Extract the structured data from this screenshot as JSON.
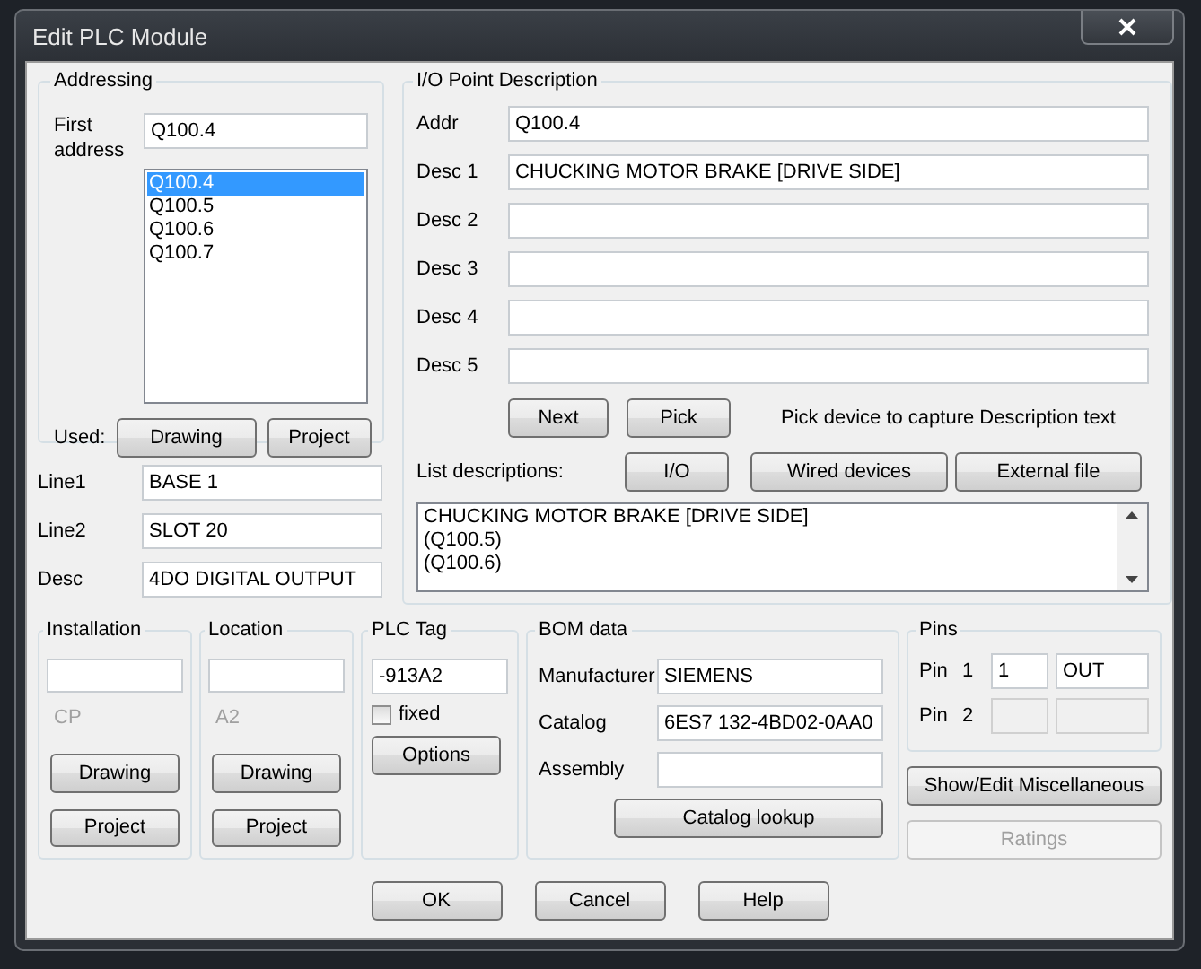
{
  "window": {
    "title": "Edit PLC Module"
  },
  "addressing": {
    "title": "Addressing",
    "first_address_label": "First address",
    "first_address": "Q100.4",
    "addresses": [
      {
        "label": "Q100.4",
        "selected": true
      },
      {
        "label": "Q100.5",
        "selected": false
      },
      {
        "label": "Q100.6",
        "selected": false
      },
      {
        "label": "Q100.7",
        "selected": false
      }
    ],
    "used_label": "Used:",
    "used_buttons": [
      "Drawing",
      "Project"
    ]
  },
  "module_fields": [
    {
      "label": "Line1",
      "value": "BASE 1"
    },
    {
      "label": "Line2",
      "value": "SLOT 20"
    },
    {
      "label": "Desc",
      "value": "4DO DIGITAL OUTPUT"
    }
  ],
  "io_point": {
    "title": "I/O Point Description",
    "fields": [
      {
        "label": "Addr",
        "value": "Q100.4"
      },
      {
        "label": "Desc 1",
        "value": "CHUCKING MOTOR BRAKE [DRIVE SIDE]"
      },
      {
        "label": "Desc 2"
      },
      {
        "label": "Desc 3"
      },
      {
        "label": "Desc 4"
      },
      {
        "label": "Desc 5"
      }
    ],
    "buttons": [
      "Next",
      "Pick"
    ],
    "pick_hint": "Pick device to capture Description text",
    "list_label": "List descriptions:",
    "list_buttons": [
      "I/O",
      "Wired devices",
      "External file"
    ],
    "descriptions": [
      "CHUCKING MOTOR BRAKE [DRIVE SIDE]",
      "(Q100.5)",
      "(Q100.6)"
    ]
  },
  "installation": {
    "title": "Installation",
    "current": "CP",
    "buttons": [
      "Drawing",
      "Project"
    ]
  },
  "location": {
    "title": "Location",
    "current": "A2",
    "buttons": [
      "Drawing",
      "Project"
    ]
  },
  "plc_tag": {
    "title": "PLC Tag",
    "value": "-913A2",
    "fixed_label": "fixed",
    "fixed": false,
    "button": "Options"
  },
  "bom": {
    "title": "BOM data",
    "fields": [
      {
        "label": "Manufacturer",
        "value": "SIEMENS"
      },
      {
        "label": "Catalog",
        "value": "6ES7 132-4BD02-0AA0"
      },
      {
        "label": "Assembly"
      }
    ],
    "button": "Catalog lookup"
  },
  "pins": {
    "title": "Pins",
    "rows": [
      {
        "label": "Pin",
        "number_label": "1",
        "pin": "1",
        "function": "OUT",
        "disabled": false
      },
      {
        "label": "Pin",
        "number_label": "2",
        "disabled": true
      }
    ]
  },
  "side_buttons": [
    {
      "label": "Show/Edit Miscellaneous",
      "disabled": false
    },
    {
      "label": "Ratings",
      "disabled": true
    }
  ],
  "footer_buttons": [
    "OK",
    "Cancel",
    "Help"
  ]
}
